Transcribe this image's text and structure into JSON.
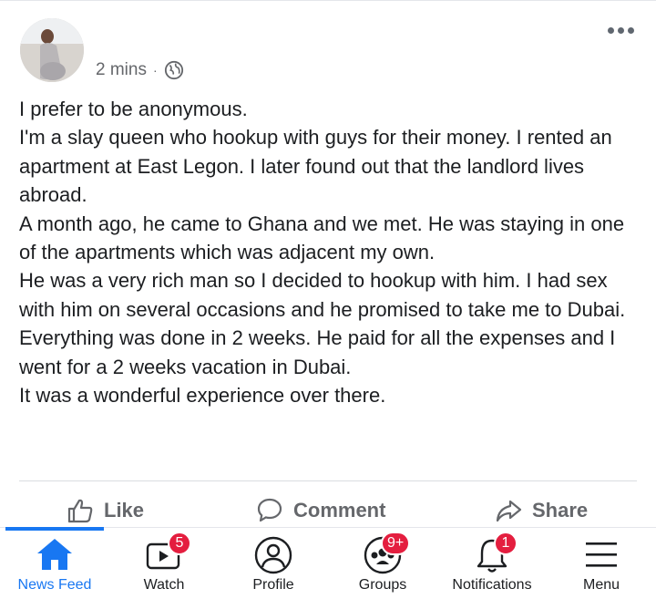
{
  "post": {
    "author_name": "",
    "timestamp": "2 mins",
    "separator": "·",
    "privacy_icon": "globe-icon",
    "body": [
      "I prefer to be anonymous.",
      "I'm a slay queen who hookup with guys for their money. I rented an apartment at East Legon. I later found out that the landlord lives abroad.",
      "A month ago, he came to Ghana and we met. He was staying in one of the apartments which was adjacent my own.",
      "He was a very rich man so I decided to hookup with him. I had sex with him on several occasions and he promised to take me to Dubai.",
      "Everything was done in 2 weeks. He paid for all the expenses and I went for a 2 weeks vacation in Dubai.",
      "It was a wonderful experience over there."
    ]
  },
  "actions": {
    "like": "Like",
    "comment": "Comment",
    "share": "Share"
  },
  "tabs": [
    {
      "label": "News Feed",
      "icon": "home-icon",
      "badge": ""
    },
    {
      "label": "Watch",
      "icon": "watch-icon",
      "badge": "5"
    },
    {
      "label": "Profile",
      "icon": "profile-icon",
      "badge": ""
    },
    {
      "label": "Groups",
      "icon": "groups-icon",
      "badge": "9+"
    },
    {
      "label": "Notifications",
      "icon": "bell-icon",
      "badge": "1"
    },
    {
      "label": "Menu",
      "icon": "menu-icon",
      "badge": ""
    }
  ],
  "colors": {
    "accent": "#1877f2",
    "badge": "#e41e3f",
    "secondary_text": "#65676b"
  }
}
